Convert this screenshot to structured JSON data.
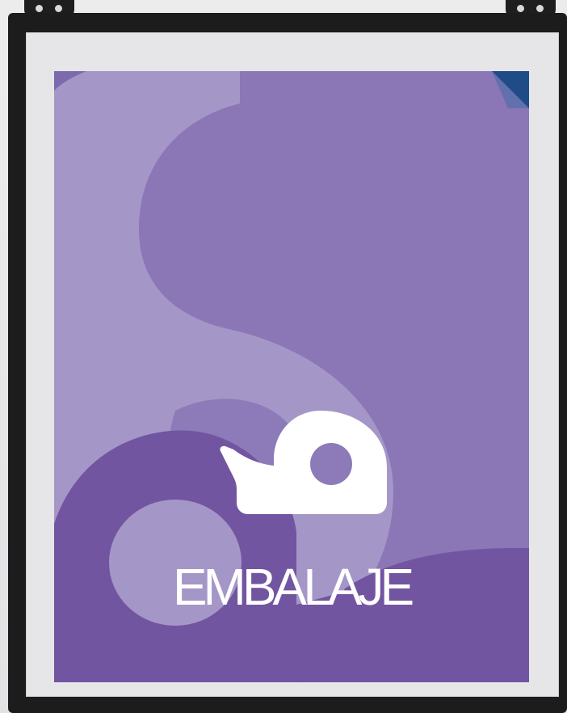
{
  "poster": {
    "title": "EMBALAJE",
    "icon": "tape-dispenser-icon",
    "colors": {
      "background": "#8b76b6",
      "light_shape": "#a596c8",
      "dark_shape": "#7255a0",
      "text": "#ffffff",
      "corner_accent": "#1f4b86"
    }
  },
  "frame": {
    "color": "#1c1c1c",
    "mat_color": "#e6e6e8"
  }
}
